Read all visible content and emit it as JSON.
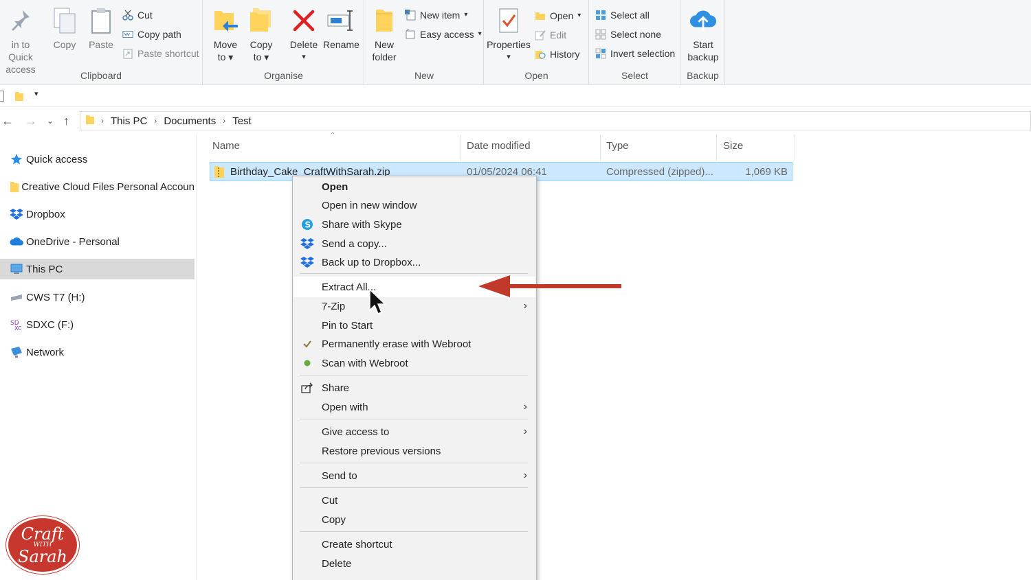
{
  "ribbon": {
    "clipboard": {
      "label": "Clipboard",
      "pin_line1": "in to Quick",
      "pin_line2": "access",
      "copy": "Copy",
      "paste": "Paste",
      "cut": "Cut",
      "copy_path": "Copy path",
      "paste_shortcut": "Paste shortcut"
    },
    "organise": {
      "label": "Organise",
      "move_to_line1": "Move",
      "move_to_line2": "to",
      "copy_to_line1": "Copy",
      "copy_to_line2": "to",
      "delete": "Delete",
      "rename": "Rename"
    },
    "new": {
      "label": "New",
      "new_folder_line1": "New",
      "new_folder_line2": "folder",
      "new_item": "New item",
      "easy_access": "Easy access"
    },
    "open": {
      "label": "Open",
      "properties": "Properties",
      "open": "Open",
      "edit": "Edit",
      "history": "History"
    },
    "select": {
      "label": "Select",
      "select_all": "Select all",
      "select_none": "Select none",
      "invert_selection": "Invert selection"
    },
    "backup": {
      "label": "Backup",
      "start_line1": "Start",
      "start_line2": "backup"
    }
  },
  "address": {
    "crumbs": [
      "This PC",
      "Documents",
      "Test"
    ]
  },
  "nav": {
    "items": [
      {
        "label": "Quick access",
        "icon": "star-icon"
      },
      {
        "label": "Creative Cloud Files Personal Accoun",
        "icon": "folder-icon"
      },
      {
        "label": "Dropbox",
        "icon": "dropbox-icon"
      },
      {
        "label": "OneDrive - Personal",
        "icon": "cloud-icon"
      },
      {
        "label": "This PC",
        "icon": "pc-icon"
      },
      {
        "label": "CWS T7 (H:)",
        "icon": "drive-icon"
      },
      {
        "label": "SDXC (F:)",
        "icon": "sd-card-icon"
      },
      {
        "label": "Network",
        "icon": "network-icon"
      }
    ]
  },
  "columns": {
    "name": "Name",
    "date": "Date modified",
    "type": "Type",
    "size": "Size"
  },
  "file": {
    "name": "Birthday_Cake_CraftWithSarah.zip",
    "date": "01/05/2024 06:41",
    "type": "Compressed (zipped)...",
    "size": "1,069 KB"
  },
  "menu": {
    "open": "Open",
    "open_new_window": "Open in new window",
    "share_skype": "Share with Skype",
    "send_copy": "Send a copy...",
    "back_up_dropbox": "Back up to Dropbox...",
    "extract_all": "Extract All...",
    "seven_zip": "7-Zip",
    "pin_start": "Pin to Start",
    "erase_webroot": "Permanently erase with Webroot",
    "scan_webroot": "Scan with Webroot",
    "share": "Share",
    "open_with": "Open with",
    "give_access": "Give access to",
    "restore_versions": "Restore previous versions",
    "send_to": "Send to",
    "cut": "Cut",
    "copy": "Copy",
    "create_shortcut": "Create shortcut",
    "delete": "Delete"
  },
  "logo": {
    "line1": "Craft",
    "line2": "WITH",
    "line3": "Sarah"
  },
  "colors": {
    "selection": "#cce8ff",
    "arrow": "#c0392b",
    "logo": "#c8372d"
  }
}
